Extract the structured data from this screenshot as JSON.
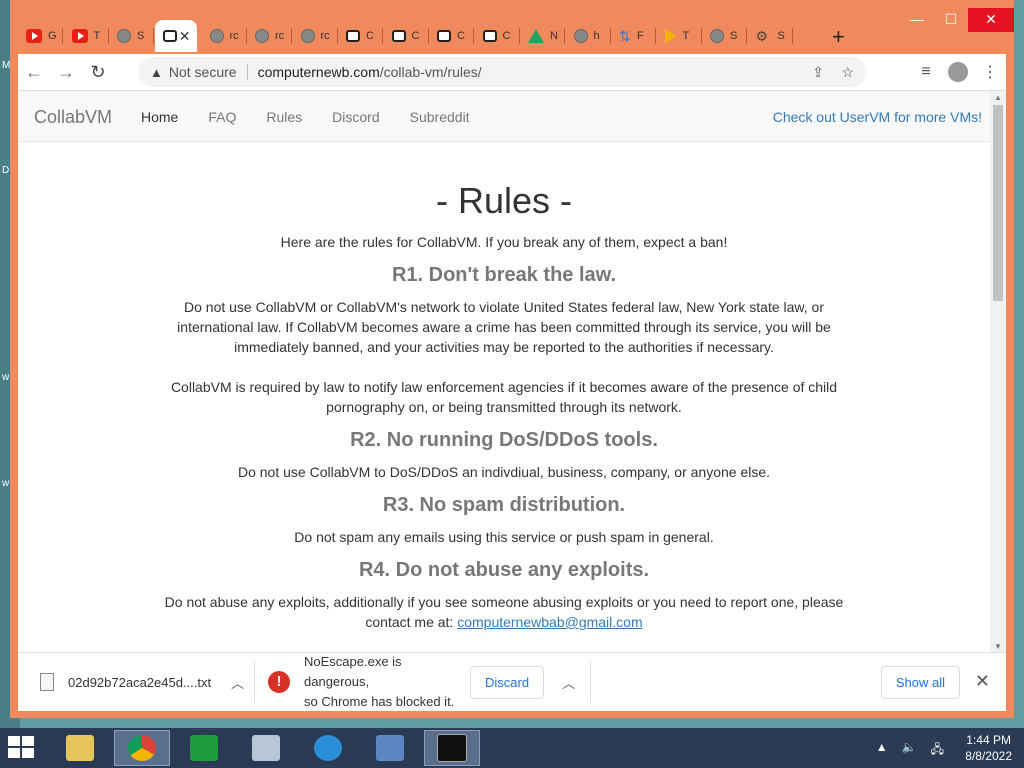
{
  "browser": {
    "tabs": [
      {
        "icon": "youtube-icon",
        "label": "G"
      },
      {
        "icon": "youtube-icon",
        "label": "T"
      },
      {
        "icon": "globe-icon",
        "label": "S"
      },
      {
        "icon": "collabvm-icon",
        "label": "",
        "active": true
      },
      {
        "icon": "globe-icon",
        "label": "rc"
      },
      {
        "icon": "globe-icon",
        "label": "rc"
      },
      {
        "icon": "globe-icon",
        "label": "rc"
      },
      {
        "icon": "collabvm-icon",
        "label": "C"
      },
      {
        "icon": "collabvm-icon",
        "label": "C"
      },
      {
        "icon": "collabvm-icon",
        "label": "C"
      },
      {
        "icon": "collabvm-icon",
        "label": "C"
      },
      {
        "icon": "drive-icon",
        "label": "N"
      },
      {
        "icon": "globe-icon",
        "label": "h"
      },
      {
        "icon": "arrow-icon",
        "label": "F"
      },
      {
        "icon": "play-icon",
        "label": "T"
      },
      {
        "icon": "globe-icon",
        "label": "S"
      },
      {
        "icon": "gear-icon",
        "label": "S"
      }
    ],
    "new_tab": "+",
    "security_label": "Not secure",
    "url_host": "computernewb.com",
    "url_path": "/collab-vm/rules/"
  },
  "site": {
    "brand": "CollabVM",
    "nav": [
      "Home",
      "FAQ",
      "Rules",
      "Discord",
      "Subreddit"
    ],
    "nav_right": "Check out UserVM for more VMs!"
  },
  "page": {
    "title": "- Rules -",
    "intro": "Here are the rules for CollabVM. If you break any of them, expect a ban!",
    "rules": [
      {
        "heading": "R1. Don't break the law.",
        "paragraphs": [
          "Do not use CollabVM or CollabVM's network to violate United States federal law, New York state law, or international law. If CollabVM becomes aware a crime has been committed through its service, you will be immediately banned, and your activities may be reported to the authorities if necessary.",
          "CollabVM is required by law to notify law enforcement agencies if it becomes aware of the presence of child pornography on, or being transmitted through its network."
        ]
      },
      {
        "heading": "R2. No running DoS/DDoS tools.",
        "paragraphs": [
          "Do not use CollabVM to DoS/DDoS an indivdiual, business, company, or anyone else."
        ]
      },
      {
        "heading": "R3. No spam distribution.",
        "paragraphs": [
          "Do not spam any emails using this service or push spam in general."
        ]
      },
      {
        "heading": "R4. Do not abuse any exploits.",
        "paragraphs": [
          "Do not abuse any exploits, additionally if you see someone abusing exploits or you need to report one, please contact me at:"
        ],
        "email": "computernewbab@gmail.com"
      }
    ]
  },
  "downloads": {
    "file1": "02d92b72aca2e45d....txt",
    "file2_warning_line1": "NoEscape.exe is dangerous,",
    "file2_warning_line2": "so Chrome has blocked it.",
    "discard": "Discard",
    "show_all": "Show all"
  },
  "taskbar": {
    "time": "1:44 PM",
    "date": "8/8/2022"
  }
}
